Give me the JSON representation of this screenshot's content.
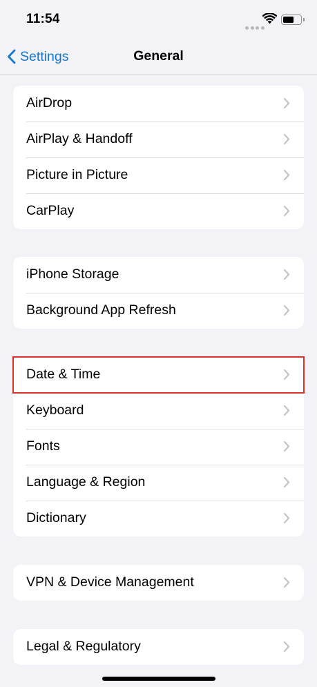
{
  "status_bar": {
    "time": "11:54"
  },
  "nav": {
    "back_label": "Settings",
    "title": "General"
  },
  "groups": [
    {
      "items": [
        {
          "label": "AirDrop"
        },
        {
          "label": "AirPlay & Handoff"
        },
        {
          "label": "Picture in Picture"
        },
        {
          "label": "CarPlay"
        }
      ]
    },
    {
      "items": [
        {
          "label": "iPhone Storage"
        },
        {
          "label": "Background App Refresh"
        }
      ]
    },
    {
      "items": [
        {
          "label": "Date & Time"
        },
        {
          "label": "Keyboard"
        },
        {
          "label": "Fonts"
        },
        {
          "label": "Language & Region"
        },
        {
          "label": "Dictionary"
        }
      ]
    },
    {
      "items": [
        {
          "label": "VPN & Device Management"
        }
      ]
    },
    {
      "items": [
        {
          "label": "Legal & Regulatory"
        }
      ]
    }
  ],
  "highlighted_item": "Date & Time",
  "colors": {
    "accent": "#1477d4",
    "highlight_border": "#d9342b",
    "background": "#f2f2f7"
  },
  "icons": [
    "wifi-icon",
    "battery-icon",
    "chevron-left-icon",
    "chevron-right-icon"
  ]
}
